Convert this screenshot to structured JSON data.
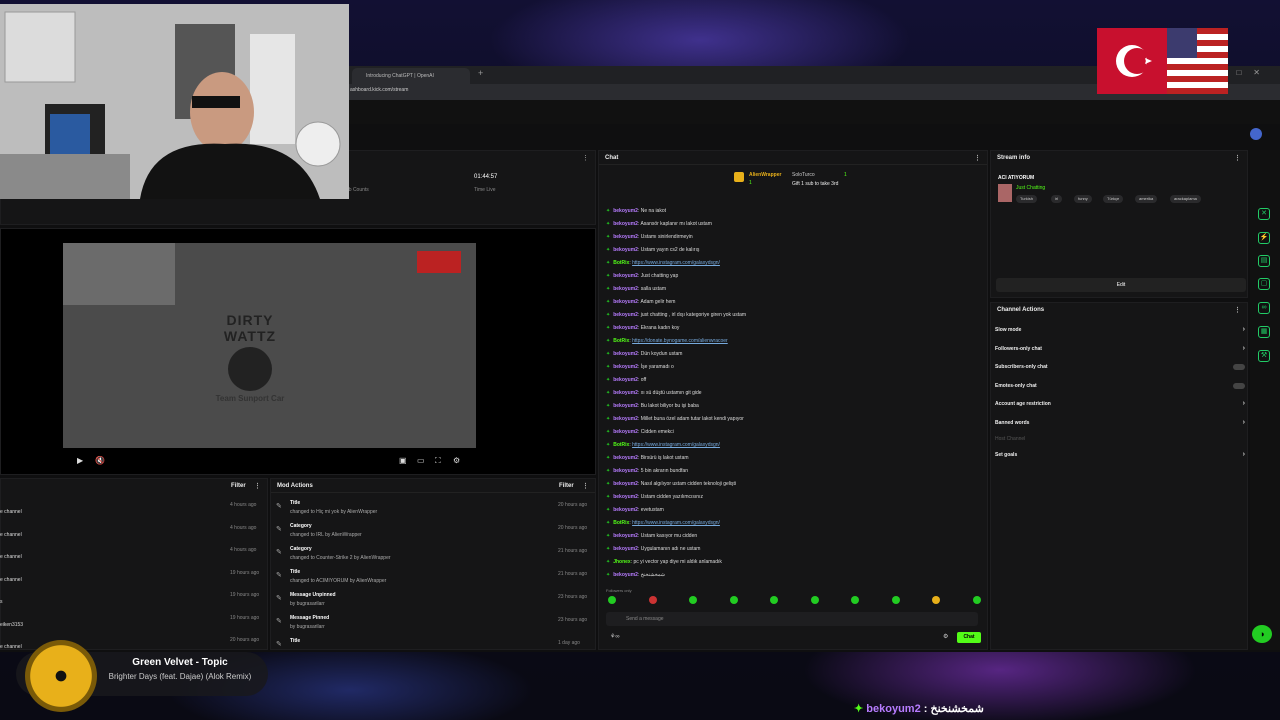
{
  "browser": {
    "tab_title": "Introducing ChatGPT | OpenAI",
    "url": "ashboard.kick.com/stream"
  },
  "stats": {
    "time_value": "01:44:57",
    "time_label": "Time Live",
    "sub_counts_label": "ub Counts"
  },
  "video": {
    "logo_title": "DIRTY WATTZ",
    "logo_sub": "Team Sunport Car"
  },
  "activity": {
    "filter": "Filter",
    "rows": [
      {
        "text": "e channel",
        "time": "4 hours ago"
      },
      {
        "text": "e channel",
        "time": "4 hours ago"
      },
      {
        "text": "e channel",
        "time": "4 hours ago"
      },
      {
        "text": "e channel",
        "time": "19 hours ago"
      },
      {
        "text": "s",
        "time": "19 hours ago"
      },
      {
        "text": "eiken3153",
        "time": "19 hours ago"
      },
      {
        "text": "e channel",
        "time": "20 hours ago"
      }
    ]
  },
  "mod": {
    "title": "Mod Actions",
    "filter": "Filter",
    "rows": [
      {
        "action": "Title",
        "detail": "changed to Hiç mi yok by AlienWrapper",
        "time": "20 hours ago"
      },
      {
        "action": "Category",
        "detail": "changed to IRL by AlienWrapper",
        "time": "20 hours ago"
      },
      {
        "action": "Category",
        "detail": "changed to Counter-Strike 2 by AlienWrapper",
        "time": "21 hours ago"
      },
      {
        "action": "Title",
        "detail": "changed to ACIMIYORUM by AlienWrapper",
        "time": "21 hours ago"
      },
      {
        "action": "Message Unpinned",
        "detail": "by bugrasarilarr",
        "time": "23 hours ago"
      },
      {
        "action": "Message Pinned",
        "detail": "by bugrasarilarr",
        "time": "23 hours ago"
      },
      {
        "action": "Title",
        "detail": "",
        "time": "1 day ago"
      }
    ]
  },
  "chat": {
    "title": "Chat",
    "pinned": {
      "user": "AlienWrapper",
      "count": "1",
      "other": "SoloTurco",
      "count2": "1",
      "text": "Gift 1 sub to take 3rd"
    },
    "messages": [
      {
        "user": "bekoyum2",
        "text": "Ne na iakot",
        "color": "#b77cff"
      },
      {
        "user": "bekoyum2",
        "text": "Asansör kaplanır mı lakot ustam",
        "color": "#b77cff"
      },
      {
        "user": "bekoyum2",
        "text": "Ustamı sinirlendirmeyin",
        "color": "#b77cff"
      },
      {
        "user": "bekoyum2",
        "text": "Ustam yayın cs2 de kalırış",
        "color": "#b77cff"
      },
      {
        "user": "BotRix",
        "text": "https://www.instagram.com/galaxydsgn/",
        "color": "#53fc18",
        "link": true
      },
      {
        "user": "bekoyum2",
        "text": "Just chatting yap",
        "color": "#b77cff"
      },
      {
        "user": "bekoyum2",
        "text": "salla ustam",
        "color": "#b77cff"
      },
      {
        "user": "bekoyum2",
        "text": "Adam gelir hem",
        "color": "#b77cff"
      },
      {
        "user": "bekoyum2",
        "text": "just chatting , irl dışı kategoriye giren yok ustam",
        "color": "#b77cff"
      },
      {
        "user": "bekoyum2",
        "text": "Ekrana kadın koy",
        "color": "#b77cff"
      },
      {
        "user": "BotRix",
        "text": "https://donate.bynogame.com/alienwracoer",
        "color": "#53fc18",
        "link": true
      },
      {
        "user": "bekoyum2",
        "text": "Dün koydun ustam",
        "color": "#b77cff"
      },
      {
        "user": "bekoyum2",
        "text": "İşe yaramadı o",
        "color": "#b77cff"
      },
      {
        "user": "bekoyum2",
        "text": "off",
        "color": "#b77cff"
      },
      {
        "user": "bekoyum2",
        "text": "xı sü düştü ustamın git gide",
        "color": "#b77cff"
      },
      {
        "user": "bekoyum2",
        "text": "Bu lakot biliyor bu işi baba",
        "color": "#b77cff"
      },
      {
        "user": "bekoyum2",
        "text": "Millet buna özel adam tutar lakot kendi yapıyor",
        "color": "#b77cff"
      },
      {
        "user": "bekoyum2",
        "text": "Cidden emekci",
        "color": "#b77cff"
      },
      {
        "user": "BotRix",
        "text": "https://www.instagram.com/galaxydsgn/",
        "color": "#53fc18",
        "link": true
      },
      {
        "user": "bekoyum2",
        "text": "Birsürü iş lakot ustam",
        "color": "#b77cff"
      },
      {
        "user": "bekoyum2",
        "text": "5 bin akrarın bundfan",
        "color": "#b77cff"
      },
      {
        "user": "bekoyum2",
        "text": "Nasıl algılıyor ustam cidden teknoloji gelişti",
        "color": "#b77cff"
      },
      {
        "user": "bekoyum2",
        "text": "Ustam cidden yazılımcısınız",
        "color": "#b77cff"
      },
      {
        "user": "bekoyum2",
        "text": "evetustam",
        "color": "#b77cff"
      },
      {
        "user": "BotRix",
        "text": "https://www.instagram.com/galaxydsgn/",
        "color": "#53fc18",
        "link": true
      },
      {
        "user": "bekoyum2",
        "text": "Ustam kasıyor mu cidden",
        "color": "#b77cff"
      },
      {
        "user": "bekoyum2",
        "text": "Uygulamanın adı ne ustam",
        "color": "#b77cff"
      },
      {
        "user": "Jhonex",
        "text": "pc yi vector yap diye mi aldık anlamadık",
        "color": "#53fc18"
      },
      {
        "user": "bekoyum2",
        "text": "شمخشنخنخ",
        "color": "#b77cff"
      }
    ],
    "followers_only": "Followers only",
    "input_placeholder": "Send a message",
    "send": "Chat"
  },
  "stream_info": {
    "title": "Stream info",
    "stream_title": "ACI ATIYORUM",
    "category": "Just Chatting",
    "tags": [
      "Turkish",
      "irl",
      "funny",
      "Türkçe",
      "amerika",
      "arackaplama"
    ],
    "edit": "Edit"
  },
  "channel_actions": {
    "title": "Channel Actions",
    "items": [
      {
        "label": "Slow mode",
        "kind": "chevron"
      },
      {
        "label": "Followers-only chat",
        "kind": "chevron"
      },
      {
        "label": "Subscribers-only chat",
        "kind": "toggle"
      },
      {
        "label": "Emotes-only chat",
        "kind": "toggle"
      },
      {
        "label": "Account age restriction",
        "kind": "chevron"
      },
      {
        "label": "Banned words",
        "kind": "chevron"
      }
    ],
    "host_channel": "Host Channel",
    "set_goals": "Set goals"
  },
  "now_playing": {
    "artist": "Green Velvet - Topic",
    "song": "Brighter Days (feat. Dajae) (Alok Remix)"
  },
  "overlay_chat": {
    "user": "bekoyum2",
    "text": ": شمخشنخنخ"
  }
}
